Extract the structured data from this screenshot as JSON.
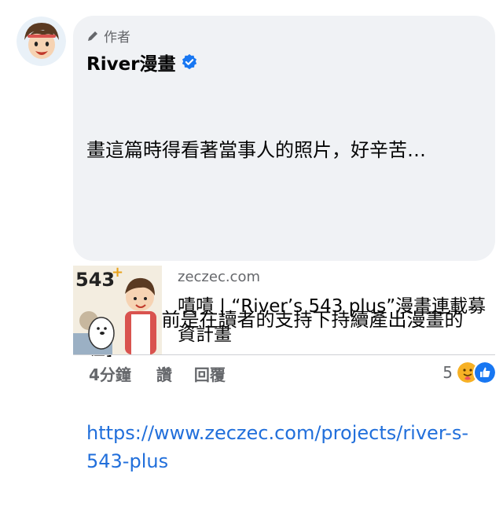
{
  "comment": {
    "author_badge": "作者",
    "author_name": "River漫畫",
    "text_line1": "畫這篇時得看著當事人的照片，好辛苦…",
    "text_line2": "[River目前是在讀者的支持下持續產出漫畫的喔]",
    "link": "https://www.zeczec.com/projects/river-s-543-plus"
  },
  "preview": {
    "domain": "zeczec.com",
    "title": "嘖嘖 | “River’s 543 plus”漫畫連載募資計畫",
    "thumb_label": "543+"
  },
  "actions": {
    "time": "4分鐘",
    "like": "讚",
    "reply": "回覆"
  },
  "reactions": {
    "count": "5",
    "types": [
      "care",
      "like"
    ]
  },
  "colors": {
    "bubble": "#f0f2f5",
    "link": "#216fdb",
    "secondary_text": "#65676b",
    "verified": "#1877f2"
  }
}
